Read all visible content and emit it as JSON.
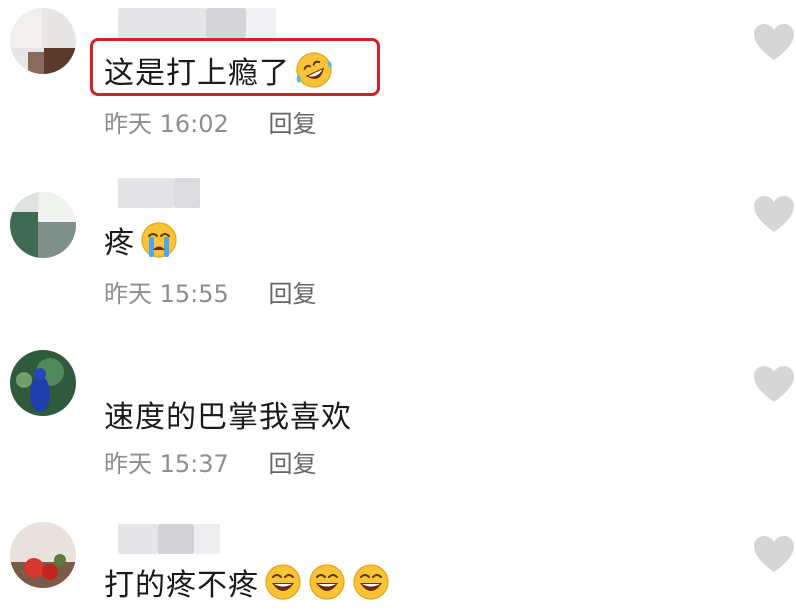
{
  "comments": [
    {
      "text": "这是打上瘾了",
      "date_label": "昨天",
      "time": "16:02",
      "reply_label": "回复",
      "emojis": [
        "rofl-emoji"
      ],
      "highlighted": true
    },
    {
      "text": "疼",
      "date_label": "昨天",
      "time": "15:55",
      "reply_label": "回复",
      "emojis": [
        "crying-emoji"
      ],
      "highlighted": false
    },
    {
      "text": "速度的巴掌我喜欢",
      "date_label": "昨天",
      "time": "15:37",
      "reply_label": "回复",
      "emojis": [],
      "highlighted": false
    },
    {
      "text": "打的疼不疼",
      "emojis": [
        "grinning-emoji",
        "grinning-emoji",
        "grinning-emoji"
      ],
      "highlighted": false
    }
  ],
  "colors": {
    "highlight_border": "#d61f26",
    "meta_text": "#8e8e8e",
    "heart": "#d6d6d6"
  }
}
